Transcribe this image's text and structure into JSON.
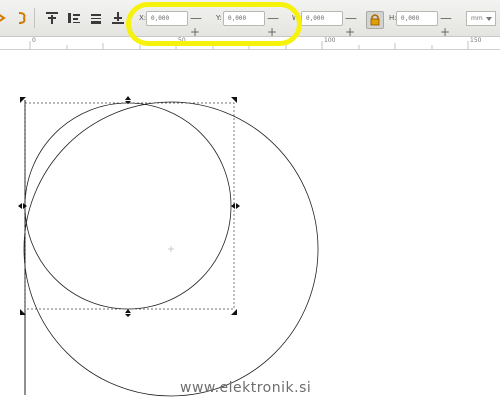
{
  "toolbar": {
    "x": {
      "label": "X:",
      "value": "0,000"
    },
    "y": {
      "label": "Y:",
      "value": "0,000"
    },
    "w": {
      "label": "W:",
      "value": "0,000"
    },
    "h": {
      "label": "H:",
      "value": "0,000"
    },
    "stepper_glyph": "—+",
    "unit": "mm"
  },
  "ruler": {
    "labels": [
      "0",
      "50",
      "100",
      "150"
    ]
  },
  "watermark": "www.elektronik.si",
  "colors": {
    "highlight": "#f7f20c",
    "lock_icon": "#b06a00",
    "toolbar_icon": "#3a3a3a"
  }
}
